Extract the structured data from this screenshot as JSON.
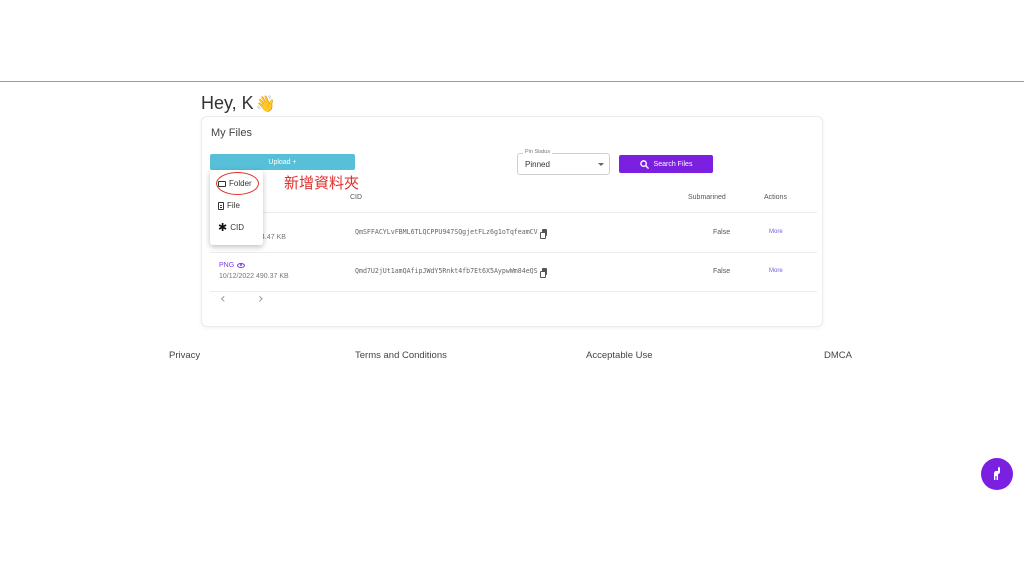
{
  "greeting": {
    "text": "Hey, K",
    "emoji": "👋"
  },
  "files_card": {
    "title": "My Files",
    "upload_label": "Upload +",
    "pin_status": {
      "legend": "Pin Status",
      "selected": "Pinned"
    },
    "search_label": "Search Files"
  },
  "table": {
    "headers": {
      "cid": "CID",
      "submarined": "Submarined",
      "actions": "Actions"
    },
    "rows": [
      {
        "meta": "4.47 KB",
        "cid": "QmSFFACYLvFBML6TLQCPPU947SQgjetFLz6g1oTqfeamCV",
        "submarined": "False",
        "action": "More"
      },
      {
        "type": "PNG",
        "meta": "10/12/2022 490.37 KB",
        "cid": "Qmd7U2jUt1amQAfipJWdY5Rnkt4fb7Et6X5AypwWm84eQS",
        "submarined": "False",
        "action": "More"
      }
    ],
    "pager": {
      "prev": "‹",
      "next": "›"
    }
  },
  "upload_menu": {
    "items": [
      {
        "label": "Folder",
        "icon": "folder-icon"
      },
      {
        "label": "File",
        "icon": "file-icon"
      },
      {
        "label": "CID",
        "icon": "asterisk-icon"
      }
    ]
  },
  "annotation": {
    "text": "新增資料夾",
    "color": "#e0302c"
  },
  "footer": {
    "privacy": "Privacy",
    "terms": "Terms and Conditions",
    "acceptable_use": "Acceptable Use",
    "dmca": "DMCA"
  },
  "colors": {
    "accent": "#7b1fe0",
    "upload": "#58bfd9",
    "top_rule": "#c77ad0"
  }
}
